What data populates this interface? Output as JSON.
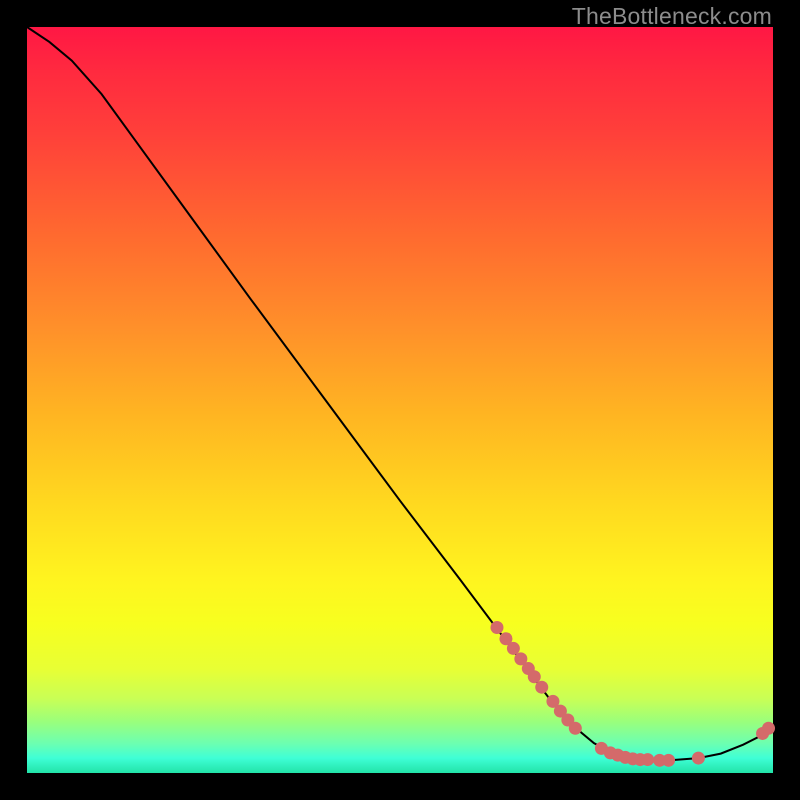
{
  "watermark": "TheBottleneck.com",
  "chart_data": {
    "type": "line",
    "title": "",
    "xlabel": "",
    "ylabel": "",
    "xlim": [
      0,
      100
    ],
    "ylim": [
      0,
      100
    ],
    "curve": [
      {
        "x": 0,
        "y": 100
      },
      {
        "x": 3,
        "y": 98
      },
      {
        "x": 6,
        "y": 95.5
      },
      {
        "x": 10,
        "y": 91
      },
      {
        "x": 14,
        "y": 85.5
      },
      {
        "x": 22,
        "y": 74.5
      },
      {
        "x": 30,
        "y": 63.5
      },
      {
        "x": 40,
        "y": 50
      },
      {
        "x": 50,
        "y": 36.5
      },
      {
        "x": 58,
        "y": 26
      },
      {
        "x": 64,
        "y": 18
      },
      {
        "x": 70,
        "y": 10
      },
      {
        "x": 73,
        "y": 6.5
      },
      {
        "x": 76,
        "y": 4
      },
      {
        "x": 79,
        "y": 2.4
      },
      {
        "x": 82,
        "y": 1.8
      },
      {
        "x": 86,
        "y": 1.7
      },
      {
        "x": 90,
        "y": 2
      },
      {
        "x": 93,
        "y": 2.6
      },
      {
        "x": 96,
        "y": 3.8
      },
      {
        "x": 98,
        "y": 4.8
      },
      {
        "x": 100,
        "y": 6.5
      }
    ],
    "points": [
      {
        "x": 63,
        "y": 19.5
      },
      {
        "x": 64.2,
        "y": 18
      },
      {
        "x": 65.2,
        "y": 16.7
      },
      {
        "x": 66.2,
        "y": 15.3
      },
      {
        "x": 67.2,
        "y": 14
      },
      {
        "x": 68,
        "y": 12.9
      },
      {
        "x": 69,
        "y": 11.5
      },
      {
        "x": 70.5,
        "y": 9.6
      },
      {
        "x": 71.5,
        "y": 8.3
      },
      {
        "x": 72.5,
        "y": 7.1
      },
      {
        "x": 73.5,
        "y": 6
      },
      {
        "x": 77,
        "y": 3.3
      },
      {
        "x": 78.2,
        "y": 2.7
      },
      {
        "x": 79.2,
        "y": 2.4
      },
      {
        "x": 80.2,
        "y": 2.1
      },
      {
        "x": 81.2,
        "y": 1.9
      },
      {
        "x": 82.2,
        "y": 1.8
      },
      {
        "x": 83.2,
        "y": 1.8
      },
      {
        "x": 84.8,
        "y": 1.7
      },
      {
        "x": 86,
        "y": 1.7
      },
      {
        "x": 90,
        "y": 2
      },
      {
        "x": 98.6,
        "y": 5.3
      },
      {
        "x": 99.4,
        "y": 6
      }
    ]
  }
}
